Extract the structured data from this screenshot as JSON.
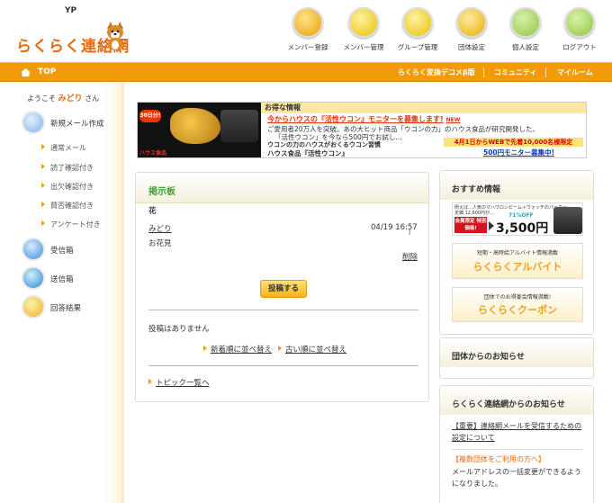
{
  "header": {
    "brand_small": "YP",
    "logo": "らくらく連絡網",
    "nav": [
      {
        "label": "メンバー登録",
        "icon": "member-register-icon",
        "color": "#e8a000"
      },
      {
        "label": "メンバー管理",
        "icon": "member-manage-icon",
        "color": "#e8c000"
      },
      {
        "label": "グループ管理",
        "icon": "group-manage-icon",
        "color": "#e8c000"
      },
      {
        "label": "団体設定",
        "icon": "group-settings-icon",
        "color": "#e8b000"
      },
      {
        "label": "個人設定",
        "icon": "personal-settings-icon",
        "color": "#8cc63f"
      },
      {
        "label": "ログアウト",
        "icon": "logout-icon",
        "color": "#8cc63f"
      }
    ]
  },
  "bar": {
    "top": "TOP",
    "links": [
      "らくらく変換デコメβ版",
      "コミュニティ",
      "マイルーム"
    ],
    "accent": "#f29b0a"
  },
  "sidebar": {
    "welcome_pre": "ようこそ",
    "user": "みどり",
    "welcome_post": "さん",
    "new_mail": "新規メール作成",
    "sub_items": [
      "通常メール",
      "読了確認付き",
      "出欠確認付き",
      "賛否確認付き",
      "アンケート付き"
    ],
    "inbox": "受信箱",
    "outbox": "送信箱",
    "results": "回答結果"
  },
  "banner": {
    "badge": "30日分!",
    "brand": "ハウス食品",
    "title": "お得な情報",
    "line1": "今からハウスの『活性ウコン』モニターを募集します!",
    "line1_new": "NEW",
    "line2": "ご愛用者20万人を突破。あの大ヒット商品「ウコンの力」のハウス食品が研究開発した、",
    "line3": "「活性ウコン」を今なら500円でお試し…",
    "line4": "ウコンの力のハウスがおくるウコン習慣",
    "line5": "ハウス食品『活性ウコン』",
    "promo1": "4月1日からWEBで先着10,000名様限定",
    "promo2": "500円モニター募集中!"
  },
  "board": {
    "title": "掲示板",
    "topic": "花",
    "author": "みどり",
    "date": "04/19 16:57",
    "body": "お花見",
    "delete": "削除",
    "post_button": "投稿する",
    "no_posts": "投稿はありません",
    "sort_new": "新着順に並べ替え",
    "sort_old": "古い順に並べ替え",
    "topic_list": "トピック一覧へ"
  },
  "right": {
    "recommend_title": "おすすめ情報",
    "ad1_top": "例えば…人気のマハワロンピーム＋ウォッチのパーカー",
    "ad1_price_label": "定価 12,600円が…",
    "ad1_badge": "会員限定 特別価格!",
    "ad1_off": "71%OFF",
    "ad1_price": "3,500円",
    "ad2_top": "短期・高時給アルバイト情報満載",
    "ad2_main": "らくらくアルバイト",
    "ad3_top": "団体でのお得宴会情報満載!",
    "ad3_main": "らくらくクーポン",
    "group_news_title": "団体からのお知らせ",
    "site_news_title": "らくらく連絡網からのお知らせ",
    "news1": "【重要】連絡網メールを受信するための設定について",
    "news2_title": "【複数団体をご利用の方へ】",
    "news2_body": "メールアドレスの一括変更ができるようになりました。"
  }
}
